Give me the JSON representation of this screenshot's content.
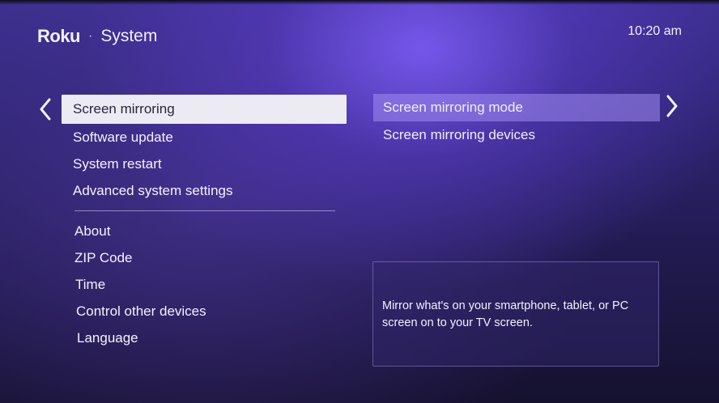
{
  "header": {
    "logo": "Roku",
    "separator": "·",
    "title": "System",
    "time": "10:20 am"
  },
  "menu": {
    "group1": [
      {
        "label": "Screen mirroring",
        "selected": true
      },
      {
        "label": "Software update"
      },
      {
        "label": "System restart"
      },
      {
        "label": "Advanced system settings"
      }
    ],
    "group2": [
      {
        "label": "About"
      },
      {
        "label": "ZIP Code"
      },
      {
        "label": "Time"
      },
      {
        "label": "Control other devices"
      },
      {
        "label": "Language"
      }
    ]
  },
  "submenu": {
    "items": [
      {
        "label": "Screen mirroring mode",
        "highlighted": true
      },
      {
        "label": "Screen mirroring devices"
      }
    ]
  },
  "description": {
    "text": "Mirror what's on your smartphone, tablet, or PC screen on to your TV screen."
  },
  "icons": {
    "left": "chevron-left-icon",
    "right": "chevron-right-icon"
  },
  "colors": {
    "selected_bg": "#ecebf3",
    "highlight_bg": "#8f7ae0",
    "accent": "#6f54e8"
  }
}
